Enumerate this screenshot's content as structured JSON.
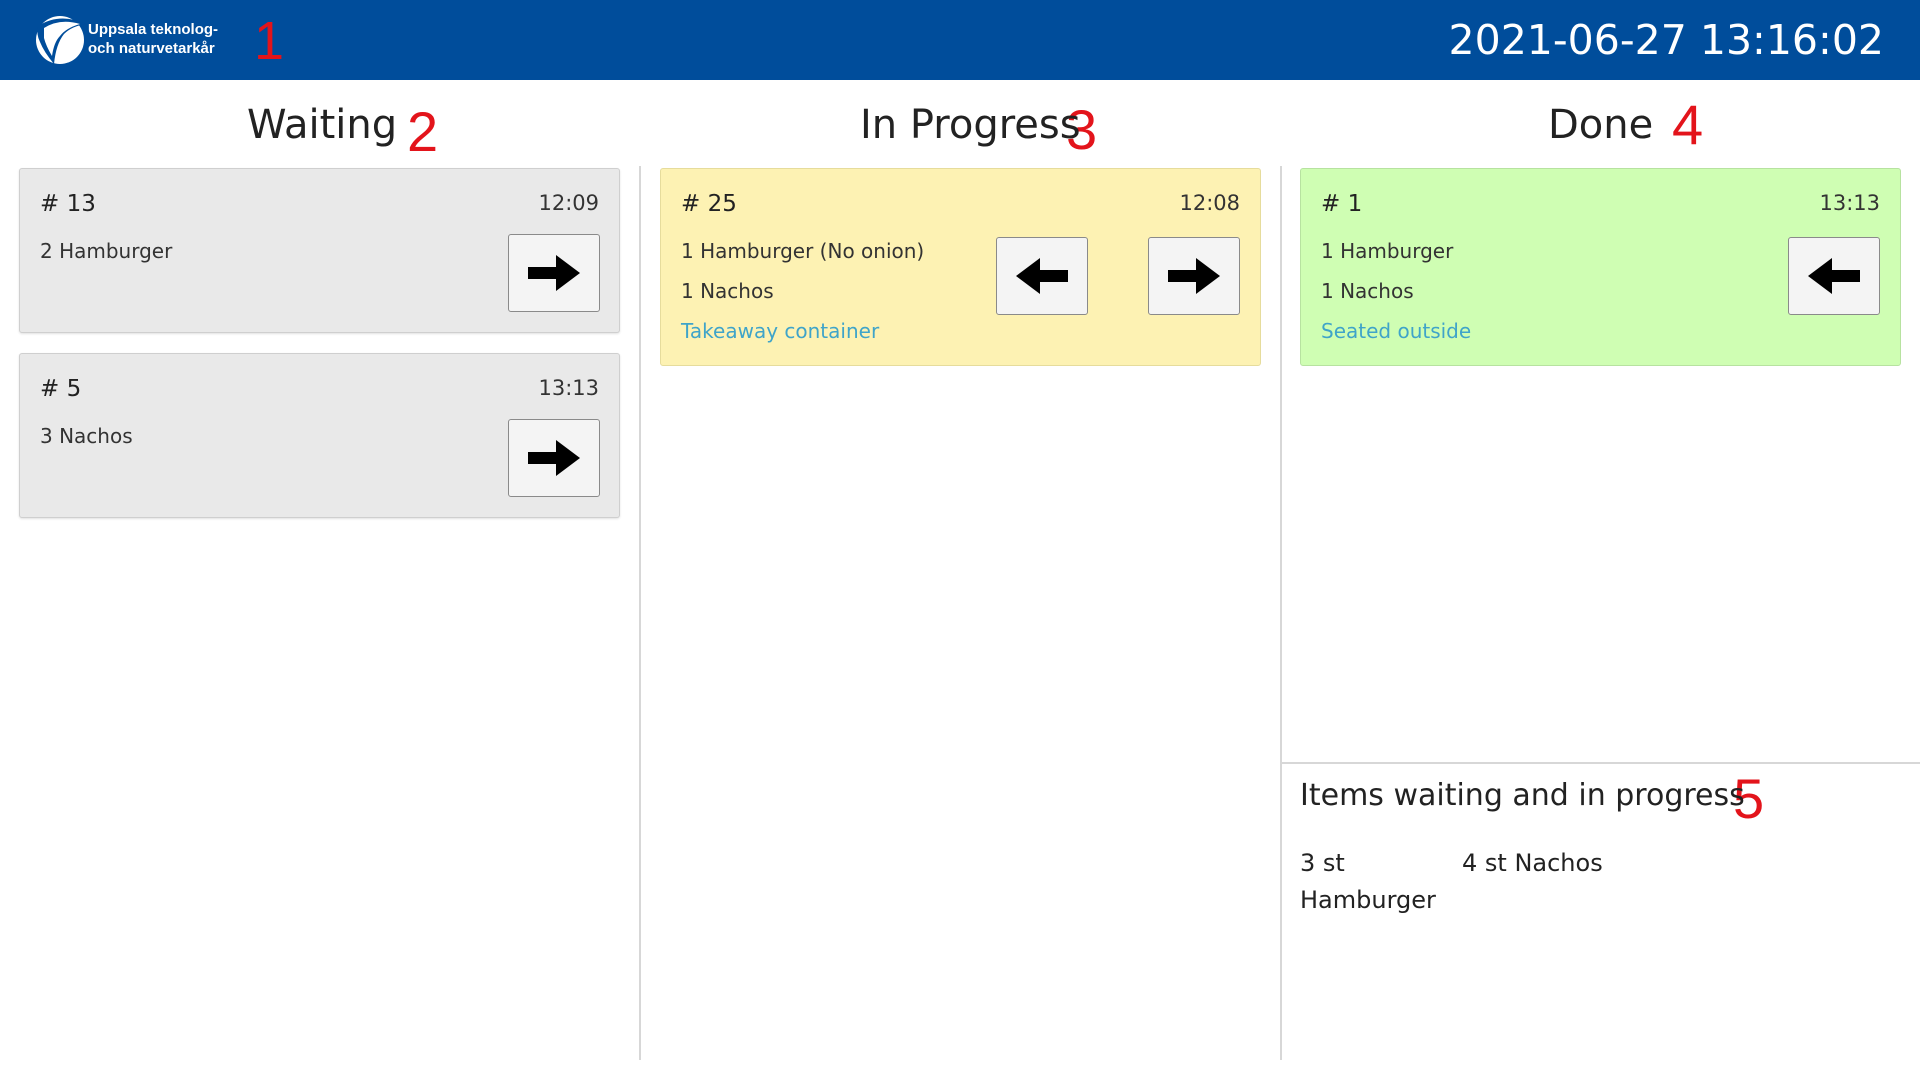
{
  "header": {
    "org_name_line1": "Uppsala teknolog-",
    "org_name_line2": "och naturvetarkår",
    "clock": "2021-06-27 13:16:02",
    "background": "#004d9b"
  },
  "annotations": [
    "1",
    "2",
    "3",
    "4",
    "5"
  ],
  "columns": {
    "waiting": {
      "title": "Waiting",
      "orders": [
        {
          "number": "# 13",
          "time": "12:09",
          "items": [
            "2 Hamburger"
          ],
          "action_icon": "arrow-right-icon"
        },
        {
          "number": "# 5",
          "time": "13:13",
          "items": [
            "3 Nachos"
          ],
          "action_icon": "arrow-right-icon"
        }
      ]
    },
    "in_progress": {
      "title": "In Progress",
      "orders": [
        {
          "number": "# 25",
          "time": "12:08",
          "items": [
            "1 Hamburger (No onion)",
            "1 Nachos"
          ],
          "note": "Takeaway container",
          "back_icon": "arrow-left-icon",
          "forward_icon": "arrow-right-icon"
        }
      ]
    },
    "done": {
      "title": "Done",
      "orders": [
        {
          "number": "# 1",
          "time": "13:13",
          "items": [
            "1 Hamburger",
            "1 Nachos"
          ],
          "note": "Seated outside",
          "back_icon": "arrow-left-icon"
        }
      ]
    }
  },
  "summary": {
    "title": "Items waiting and in progress",
    "items": [
      {
        "line1": "3 st",
        "line2": "Hamburger"
      },
      {
        "line1": "4 st Nachos"
      }
    ]
  },
  "colors": {
    "annotation": "#e3141b",
    "card_waiting": "#e9e9e9",
    "card_in_progress": "#fdf2b3",
    "card_done": "#cffeb3",
    "note_text": "#3fa4c9"
  }
}
